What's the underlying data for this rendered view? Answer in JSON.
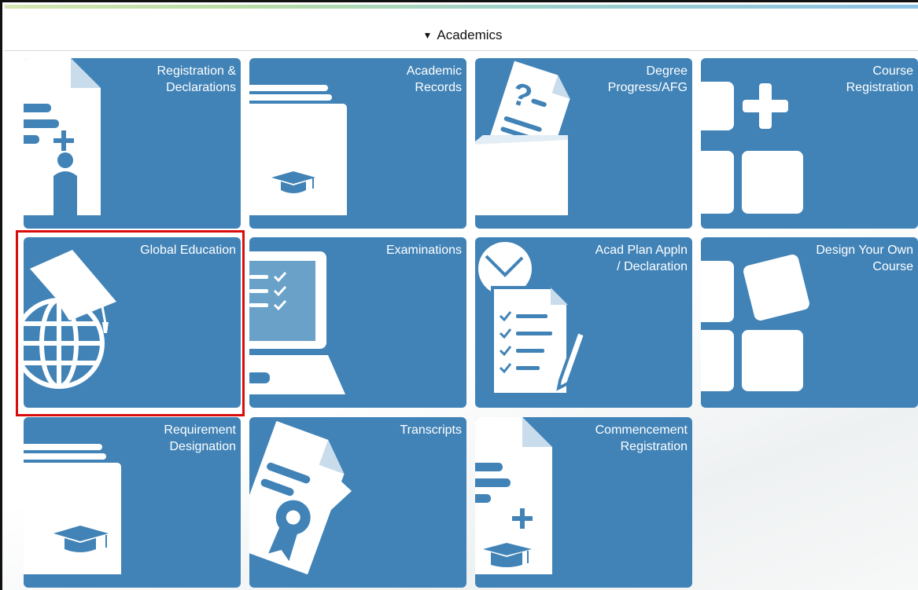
{
  "section": {
    "title": "Academics",
    "toggle_glyph": "▼"
  },
  "tiles": [
    {
      "label": "Registration &\nDeclarations",
      "icon": "document-person-add-icon"
    },
    {
      "label": "Academic\nRecords",
      "icon": "folder-graduation-cap-icon"
    },
    {
      "label": "Degree\nProgress/AFG",
      "icon": "document-question-folder-icon"
    },
    {
      "label": "Course\nRegistration",
      "icon": "blocks-plus-icon"
    },
    {
      "label": "Global Education",
      "icon": "globe-graduation-cap-icon"
    },
    {
      "label": "Examinations",
      "icon": "laptop-checklist-icon"
    },
    {
      "label": "Acad Plan Appln\n/ Declaration",
      "icon": "clock-checklist-pencil-icon"
    },
    {
      "label": "Design Your Own\nCourse",
      "icon": "tilted-blocks-icon"
    },
    {
      "label": "Requirement\nDesignation",
      "icon": "folder-graduation-cap-icon"
    },
    {
      "label": "Transcripts",
      "icon": "documents-ribbon-arrow-icon"
    },
    {
      "label": "Commencement\nRegistration",
      "icon": "document-graduation-cap-add-icon"
    }
  ],
  "colors": {
    "tile": "#4183b7",
    "selection": "#d90c0c"
  }
}
